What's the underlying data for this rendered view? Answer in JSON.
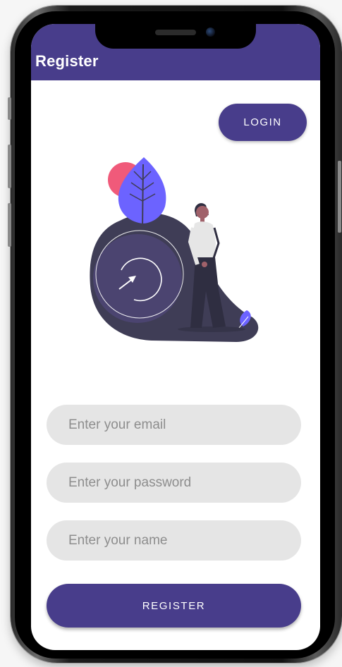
{
  "appbar": {
    "title": "Register"
  },
  "actions": {
    "login_label": "LOGIN",
    "register_label": "REGISTER"
  },
  "form": {
    "email_placeholder": "Enter your email",
    "password_placeholder": "Enter your password",
    "name_placeholder": "Enter your name"
  },
  "colors": {
    "primary": "#483d8b",
    "field_bg": "#e5e5e5",
    "leaf": "#6c63ff",
    "blob": "#3f3d56",
    "accent_circle": "#f05a7a"
  },
  "icons": [
    "leaf-icon",
    "circular-arrow-icon",
    "person-illustration"
  ]
}
